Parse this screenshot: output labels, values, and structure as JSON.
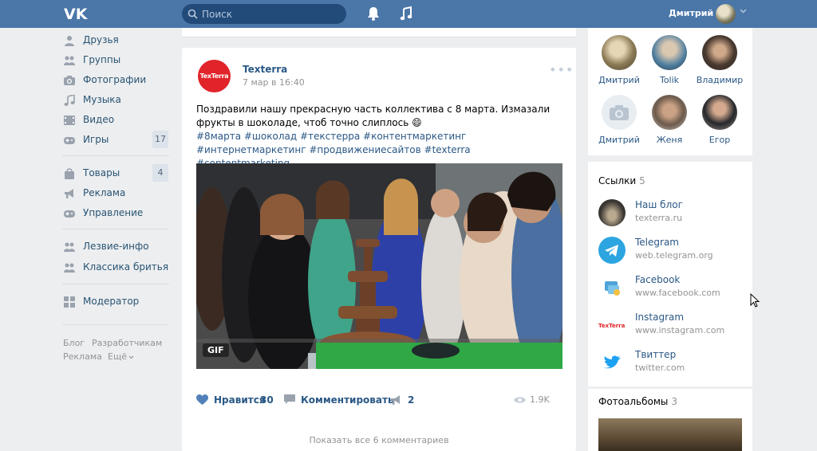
{
  "header": {
    "search_placeholder": "Поиск",
    "user_name": "Дмитрий"
  },
  "nav": {
    "items": [
      {
        "label": "Друзья",
        "icon": "person-icon"
      },
      {
        "label": "Группы",
        "icon": "group-icon"
      },
      {
        "label": "Фотографии",
        "icon": "camera-icon"
      },
      {
        "label": "Музыка",
        "icon": "music-icon"
      },
      {
        "label": "Видео",
        "icon": "video-icon"
      },
      {
        "label": "Игры",
        "icon": "gamepad-icon",
        "count": "17"
      },
      {
        "label": "Товары",
        "icon": "bag-icon",
        "count": "4"
      },
      {
        "label": "Реклама",
        "icon": "megaphone-icon"
      },
      {
        "label": "Управление",
        "icon": "gamepad-icon"
      },
      {
        "label": "Лезвие-инфо",
        "icon": "group-icon"
      },
      {
        "label": "Классика бритья",
        "icon": "group-icon"
      },
      {
        "label": "Модератор",
        "icon": "grid-icon"
      }
    ],
    "footer": [
      "Блог",
      "Разработчикам",
      "Реклама",
      "Ещё"
    ]
  },
  "post": {
    "author": "Texterra",
    "logo_text": "TexTerra",
    "date": "7 мар в 16:40",
    "text": "Поздравили нашу прекрасную часть коллектива с 8 марта. Измазали фрукты в шоколаде, чтоб точно слиплось 😄",
    "tags": "#8марта #шоколад #текстерра #контентмаркетинг #интернетмаркетинг #продвижениесайтов #texterra #contentmarketing",
    "gif_label": "GIF",
    "like_label": "Нравится",
    "like_count": "30",
    "comment_label": "Комментировать",
    "share_count": "2",
    "views": "1.9K",
    "show_comments": "Показать все 6 комментариев"
  },
  "friends": [
    {
      "name": "Дмитрий"
    },
    {
      "name": "Tolik"
    },
    {
      "name": "Владимир"
    },
    {
      "name": "Дмитрий"
    },
    {
      "name": "Женя"
    },
    {
      "name": "Егор"
    }
  ],
  "links": {
    "title": "Ссылки",
    "count": "5",
    "items": [
      {
        "title": "Наш блог",
        "url": "texterra.ru"
      },
      {
        "title": "Telegram",
        "url": "web.telegram.org"
      },
      {
        "title": "Facebook",
        "url": "www.facebook.com"
      },
      {
        "title": "Instagram",
        "url": "www.instagram.com"
      },
      {
        "title": "Твиттер",
        "url": "twitter.com"
      }
    ]
  },
  "albums": {
    "title": "Фотоальбомы",
    "count": "3"
  },
  "colors": {
    "header_bg": "#4a76a8",
    "link": "#2a5885",
    "texterra_red": "#e0242a",
    "telegram_blue": "#2ca5e0",
    "twitter_blue": "#1da1f2"
  }
}
